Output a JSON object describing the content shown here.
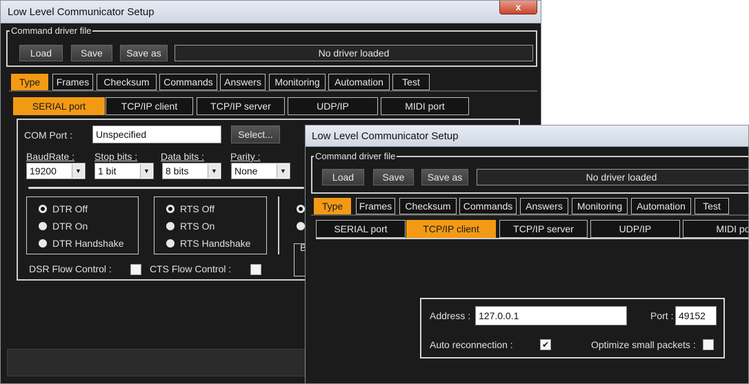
{
  "serial_window": {
    "title": "Low Level Communicator Setup",
    "close_label": "x",
    "driver_group": "Command driver file",
    "load": "Load",
    "save": "Save",
    "save_as": "Save as",
    "driver_status": "No driver loaded",
    "tabs": [
      "Type",
      "Frames",
      "Checksum",
      "Commands",
      "Answers",
      "Monitoring",
      "Automation",
      "Test"
    ],
    "subtabs": [
      "SERIAL port",
      "TCP/IP client",
      "TCP/IP server",
      "UDP/IP",
      "MIDI port"
    ],
    "com_port_label": "COM Port :",
    "com_port_value": "Unspecified",
    "select_button": "Select...",
    "baud_label": "BaudRate :",
    "baud_value": "19200",
    "stop_label": "Stop bits :",
    "stop_value": "1 bit",
    "data_label": "Data bits :",
    "data_value": "8 bits",
    "parity_label": "Parity :",
    "parity_value": "None",
    "dtr": [
      "DTR Off",
      "DTR On",
      "DTR Handshake"
    ],
    "rts": [
      "RTS Off",
      "RTS On",
      "RTS Handshake"
    ],
    "partial_letter": "B",
    "dsr_label": "DSR Flow Control :",
    "cts_label": "CTS Flow Control :"
  },
  "tcp_window": {
    "title": "Low Level Communicator Setup",
    "driver_group": "Command driver file",
    "load": "Load",
    "save": "Save",
    "save_as": "Save as",
    "driver_status": "No driver loaded",
    "tabs": [
      "Type",
      "Frames",
      "Checksum",
      "Commands",
      "Answers",
      "Monitoring",
      "Automation",
      "Test"
    ],
    "subtabs": [
      "SERIAL port",
      "TCP/IP client",
      "TCP/IP server",
      "UDP/IP",
      "MIDI port"
    ],
    "address_label": "Address :",
    "address_value": "127.0.0.1",
    "port_label": "Port :",
    "port_value": "49152",
    "auto_reconnect_label": "Auto reconnection :",
    "auto_reconnect_mark": "✔",
    "optimize_label": "Optimize small packets :"
  },
  "colors": {
    "active_tab": "#f39a14",
    "window_bg": "#1b1b1b"
  }
}
